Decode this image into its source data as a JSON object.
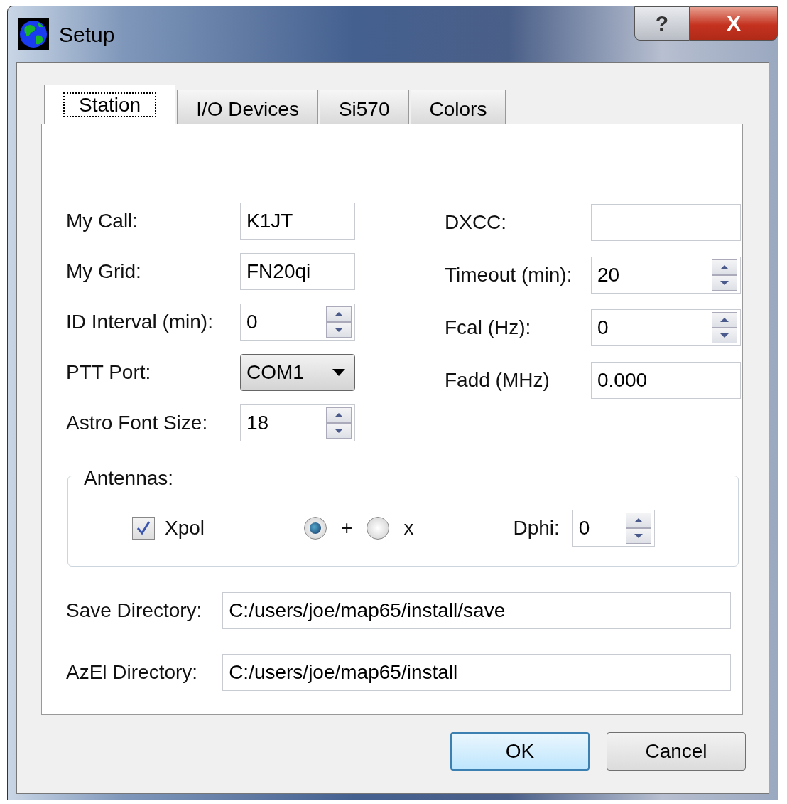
{
  "window": {
    "title": "Setup",
    "help_button": "?",
    "close_button": "X"
  },
  "tabs": [
    {
      "label": "Station",
      "selected": true
    },
    {
      "label": "I/O Devices",
      "selected": false
    },
    {
      "label": "Si570",
      "selected": false
    },
    {
      "label": "Colors",
      "selected": false
    }
  ],
  "left_fields": [
    {
      "label": "My Call:",
      "kind": "text",
      "value": "K1JT"
    },
    {
      "label": "My Grid:",
      "kind": "text",
      "value": "FN20qi"
    },
    {
      "label": "ID Interval (min):",
      "kind": "spin",
      "value": "0"
    },
    {
      "label": "PTT Port:",
      "kind": "combo",
      "value": "COM1"
    },
    {
      "label": "Astro Font Size:",
      "kind": "spin",
      "value": "18"
    }
  ],
  "right_fields": [
    {
      "label": "DXCC:",
      "kind": "text"
    },
    {
      "label": "Timeout (min):",
      "kind": "spin",
      "value": "20"
    },
    {
      "label": "Fcal (Hz):",
      "kind": "spin",
      "value": "0"
    },
    {
      "label": "Fadd (MHz)",
      "kind": "text",
      "value": "0.000"
    }
  ],
  "antennas": {
    "title": "Antennas:",
    "xpol": {
      "label": "Xpol",
      "checked": true
    },
    "polarization": [
      {
        "label": "+",
        "selected": true
      },
      {
        "label": "x",
        "selected": false
      }
    ],
    "dphi": {
      "label": "Dphi:",
      "value": "0"
    }
  },
  "directories": [
    {
      "label": "Save Directory:",
      "value": "C:/users/joe/map65/install/save"
    },
    {
      "label": "AzEl Directory:",
      "value": "C:/users/joe/map65/install"
    }
  ],
  "buttons": [
    {
      "label": "OK",
      "default": true
    },
    {
      "label": "Cancel",
      "default": false
    }
  ]
}
